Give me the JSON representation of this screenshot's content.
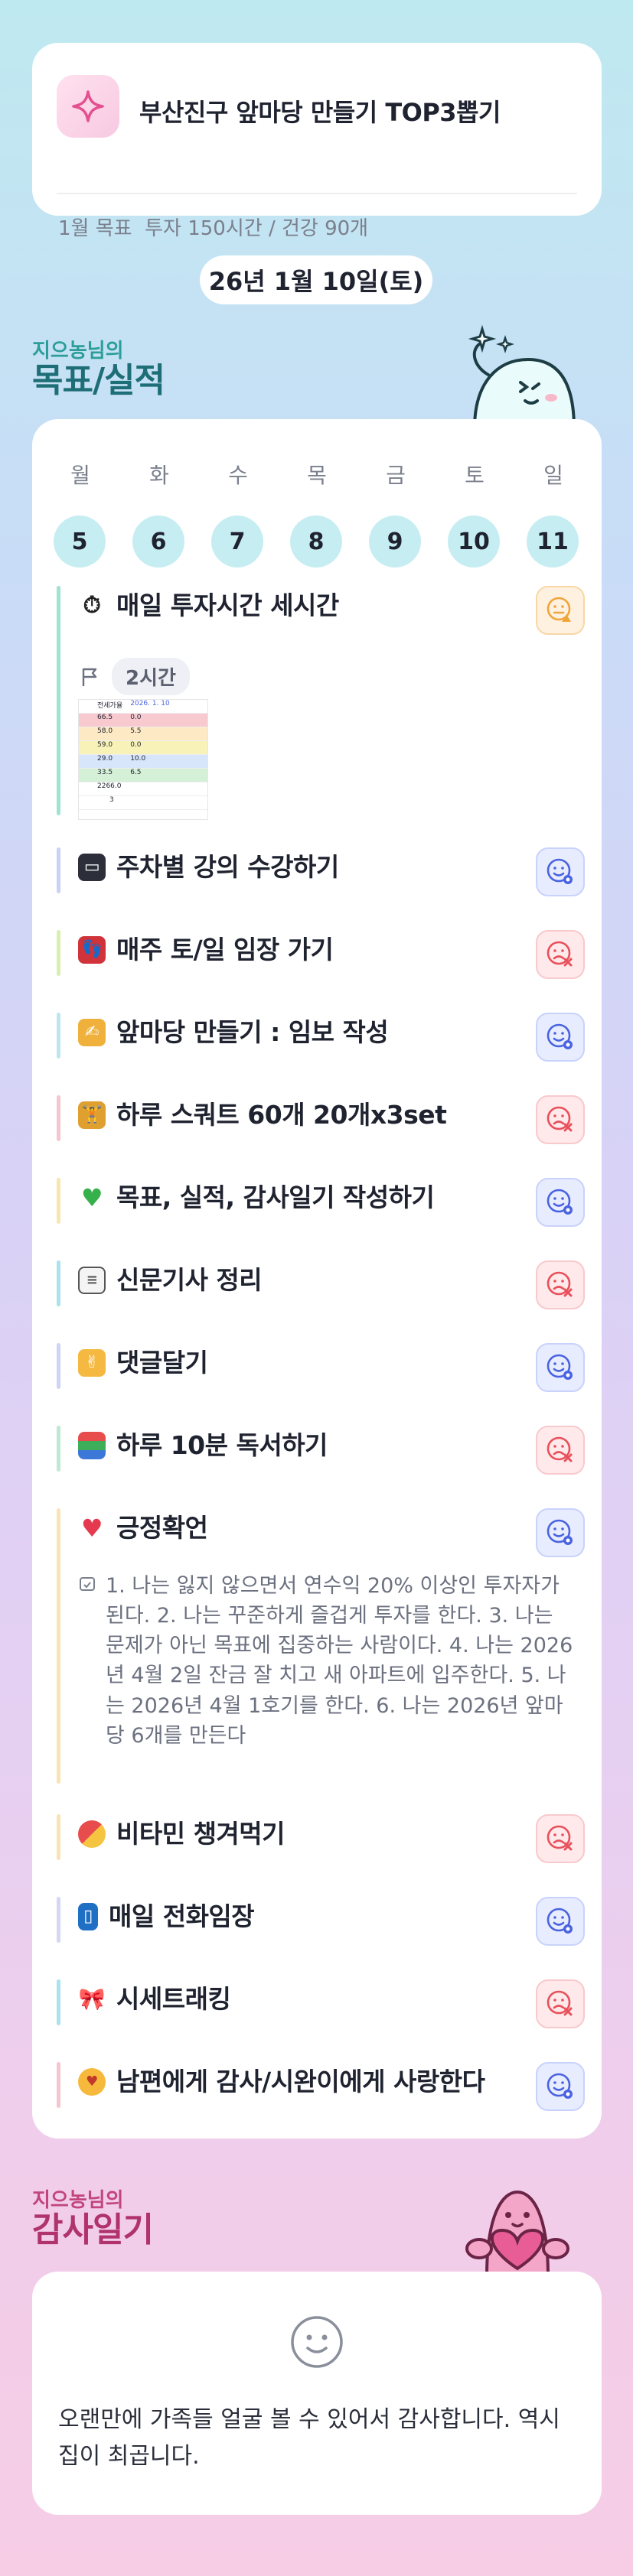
{
  "header": {
    "title": "부산진구 앞마당 만들기 TOP3뽑기",
    "goal_label": "1월 목표",
    "goal_value": "투자 150시간 / 건강 90개"
  },
  "date": "26년 1월 10일(토)",
  "goals_section": {
    "owner": "지으농님의",
    "title": "목표/실적"
  },
  "week": [
    {
      "day": "월",
      "num": "5"
    },
    {
      "day": "화",
      "num": "6"
    },
    {
      "day": "수",
      "num": "7"
    },
    {
      "day": "목",
      "num": "8"
    },
    {
      "day": "금",
      "num": "9"
    },
    {
      "day": "토",
      "num": "10"
    },
    {
      "day": "일",
      "num": "11"
    }
  ],
  "tasks": [
    {
      "icon": "stopwatch",
      "label": "매일 투자시간 세시간",
      "status": "partial",
      "time": "2시간",
      "bar_color": "#9fe3d2"
    },
    {
      "icon": "laptop",
      "label": "주차별 강의 수강하기",
      "status": "done",
      "bar_color": "#c9d2f6"
    },
    {
      "icon": "footprints",
      "label": "매주 토/일 임장 가기",
      "status": "fail",
      "bar_color": "#d9efb0"
    },
    {
      "icon": "writing-hand",
      "label": "앞마당 만들기 : 임보 작성",
      "status": "done",
      "bar_color": "#bfe6f0"
    },
    {
      "icon": "squat",
      "label": "하루 스쿼트 60개 20개x3set",
      "status": "fail",
      "bar_color": "#f5c6cf"
    },
    {
      "icon": "green-heart",
      "label": "목표, 실적, 감사일기 작성하기",
      "status": "done",
      "bar_color": "#f8e6b0"
    },
    {
      "icon": "newspaper",
      "label": "신문기사 정리",
      "status": "fail",
      "bar_color": "#a9e3ee"
    },
    {
      "icon": "hand",
      "label": "댓글달기",
      "status": "done",
      "bar_color": "#d0d4f4"
    },
    {
      "icon": "books",
      "label": "하루 10분 독서하기",
      "status": "fail",
      "bar_color": "#bfe9d4"
    },
    {
      "icon": "red-heart",
      "label": "긍정확언",
      "status": "done",
      "bar_color": "#f8e3b4",
      "note": "1. 나는 잃지 않으면서 연수익 20% 이상인 투자자가 된다. 2. 나는 꾸준하게 즐겁게 투자를 한다. 3. 나는 문제가 아닌 목표에 집중하는 사람이다. 4. 나는 2026년 4월 2일 잔금 잘 치고 새 아파트에 입주한다. 5. 나는 2026년 4월 1호기를 한다. 6. 나는 2026년 앞마당 6개를 만든다"
    },
    {
      "icon": "pill",
      "label": "비타민 챙겨먹기",
      "status": "fail",
      "bar_color": "#f8e3b4"
    },
    {
      "icon": "phone",
      "label": "매일 전화임장",
      "status": "done",
      "bar_color": "#d5d6f4"
    },
    {
      "icon": "ribbon",
      "label": "시세트래킹",
      "status": "fail",
      "bar_color": "#a9e3ee"
    },
    {
      "icon": "smiling-face-hearts",
      "label": "남편에게 감사/시완이에게 사랑한다",
      "status": "done",
      "bar_color": "#f5c6cf"
    }
  ],
  "thumbnail": {
    "header": [
      "전세가율",
      "2026. 1. 10"
    ],
    "rows": [
      [
        "66.5",
        "0.0"
      ],
      [
        "58.0",
        "5.5"
      ],
      [
        "59.0",
        "0.0"
      ],
      [
        "29.0",
        "10.0"
      ],
      [
        "33.5",
        "6.5"
      ],
      [
        "2266.0",
        ""
      ],
      [
        "3",
        ""
      ]
    ]
  },
  "gratitude": {
    "owner": "지으농님의",
    "title": "감사일기",
    "text": "오랜만에 가족들 얼굴 볼 수 있어서 감사합니다. 역시 집이 최곱니다."
  },
  "colors": {
    "accent_teal": "#1d6e76",
    "day_circle": "#c6eef2",
    "done": "#4a63e0",
    "fail": "#e8505b",
    "partial": "#f0a53c"
  }
}
